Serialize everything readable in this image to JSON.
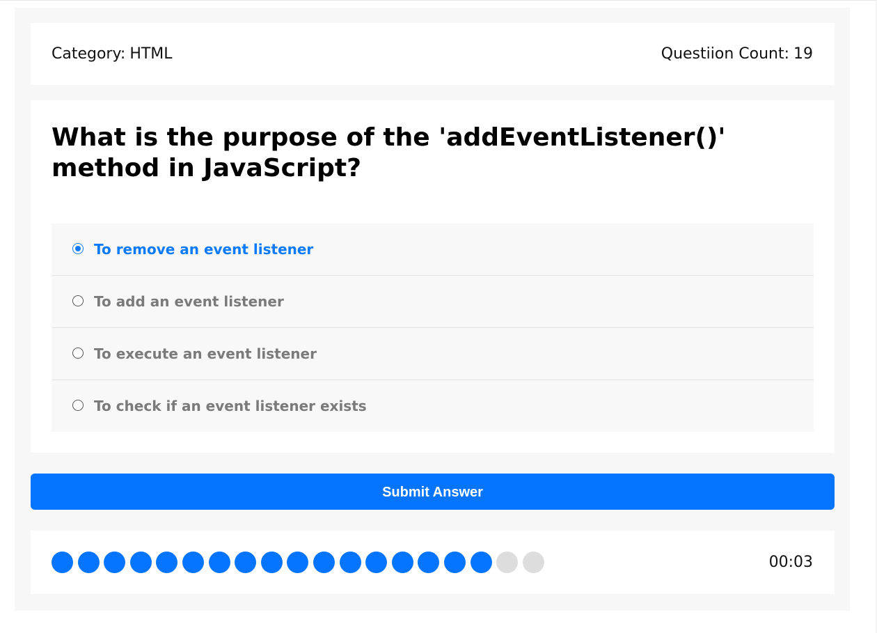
{
  "header": {
    "category_label": "Category:",
    "category_value": "HTML",
    "count_label": "Questiion Count:",
    "count_value": "19"
  },
  "question": {
    "text": "What is the purpose of the 'addEventListener()' method in JavaScript?"
  },
  "options": [
    {
      "label": "To remove an event listener",
      "selected": true
    },
    {
      "label": "To add an event listener",
      "selected": false
    },
    {
      "label": "To execute an event listener",
      "selected": false
    },
    {
      "label": "To check if an event listener exists",
      "selected": false
    }
  ],
  "submit": {
    "label": "Submit Answer"
  },
  "progress": {
    "total": 19,
    "completed": 17,
    "timer": "00:03"
  },
  "colors": {
    "accent": "#0574fe",
    "selected_text": "#0a7aff",
    "dot_pending": "#dddddd"
  }
}
